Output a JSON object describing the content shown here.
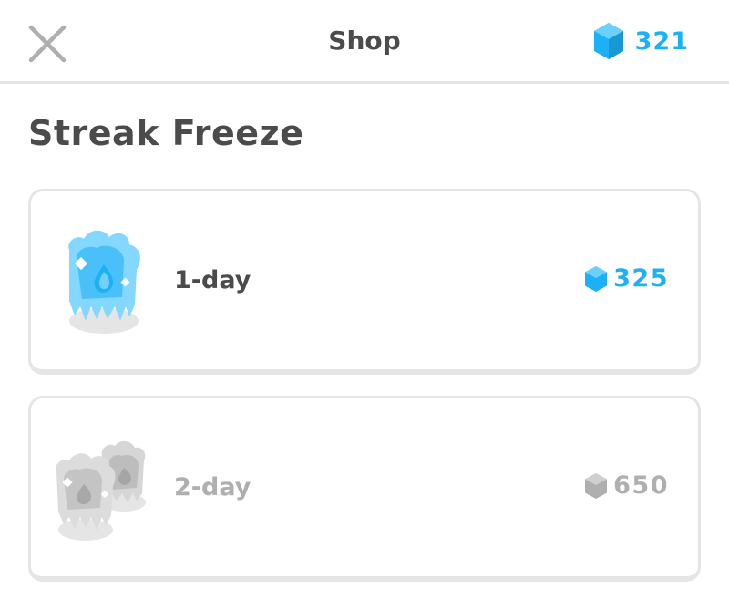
{
  "header": {
    "title": "Shop",
    "gem_balance": "321",
    "close_icon": "close-icon",
    "gem_icon": "gem-icon"
  },
  "section": {
    "title": "Streak Freeze"
  },
  "items": [
    {
      "label": "1-day",
      "price": "325",
      "icon": "streak-freeze-icon",
      "state": "enabled"
    },
    {
      "label": "2-day",
      "price": "650",
      "icon": "double-streak-freeze-icon",
      "state": "disabled"
    }
  ],
  "colors": {
    "accent": "#1cb0f6",
    "text": "#4b4b4b",
    "disabled": "#afafaf",
    "border": "#e5e5e5"
  }
}
